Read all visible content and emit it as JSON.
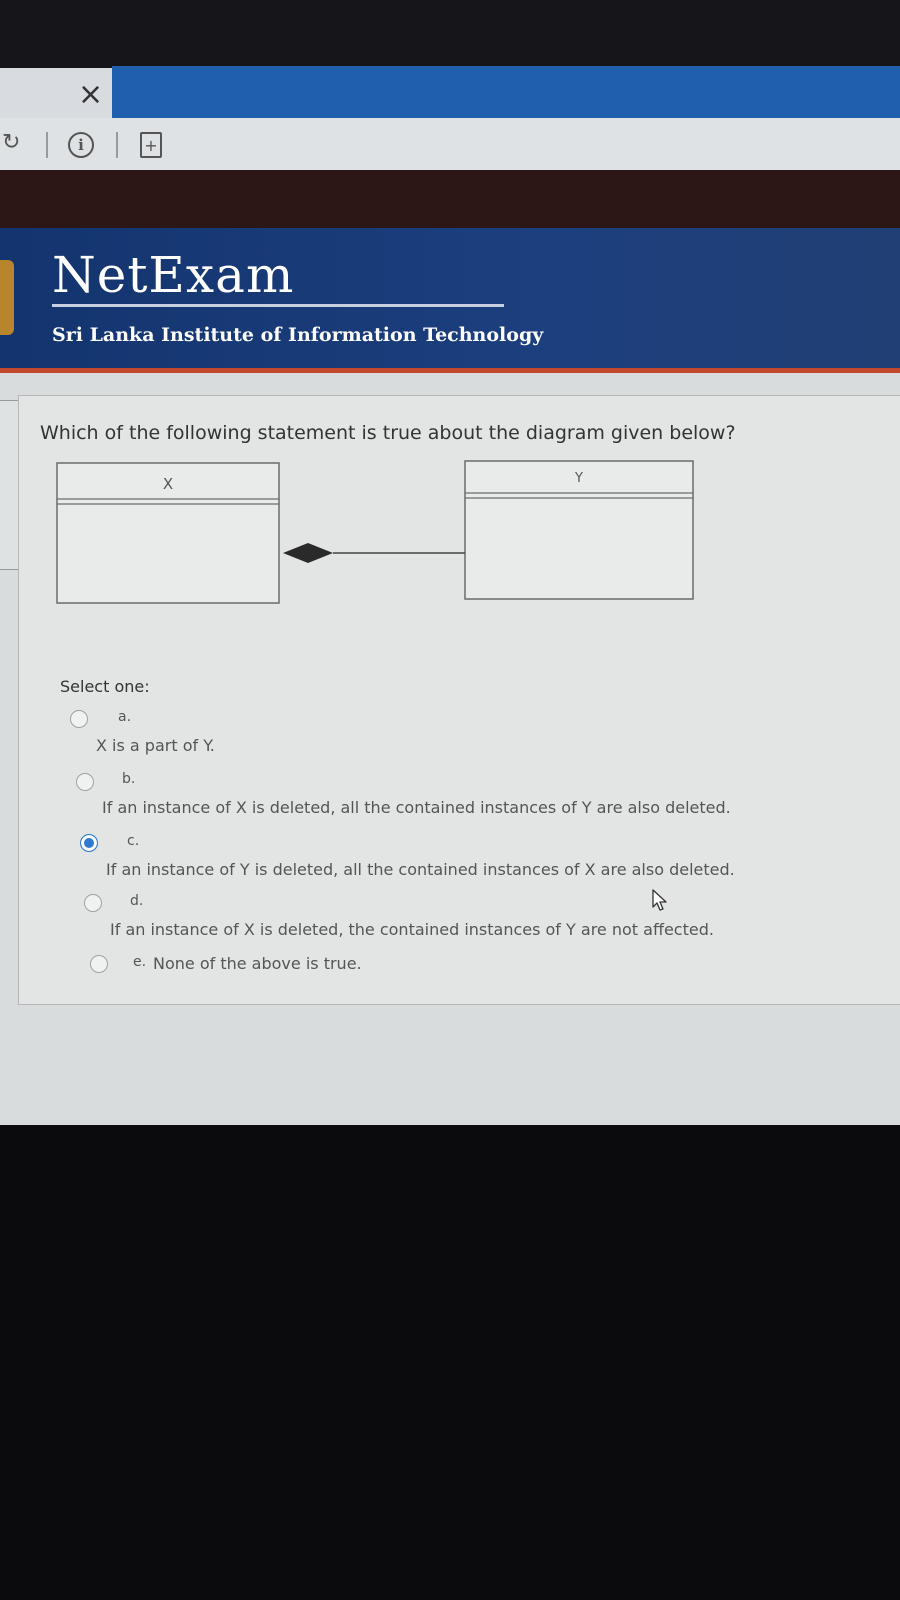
{
  "browser": {
    "close_glyph": "×",
    "refresh_glyph": "↻",
    "info_glyph": "i",
    "newtab_glyph": "+",
    "icons": [
      "close-icon",
      "refresh-icon",
      "info-icon",
      "new-tab-icon"
    ]
  },
  "header": {
    "brand": "NetExam",
    "institution": "Sri Lanka Institute of Information Technology"
  },
  "question": {
    "text": "Which of the following statement is true about the diagram given below?",
    "diagram": {
      "class_left": "X",
      "class_right": "Y",
      "relationship": "composition"
    },
    "select_label": "Select one:",
    "options": [
      {
        "letter": "a.",
        "text": "X is a part of Y.",
        "selected": false
      },
      {
        "letter": "b.",
        "text": "If an instance of X is deleted, all the contained instances of Y are also deleted.",
        "selected": false
      },
      {
        "letter": "c.",
        "text": "If an instance of Y is deleted, all the contained instances of X are also deleted.",
        "selected": true
      },
      {
        "letter": "d.",
        "text": "If an instance of X is deleted, the contained instances of Y are not affected.",
        "selected": false
      },
      {
        "letter": "e.",
        "text": "None of the above is true.",
        "selected": false
      }
    ]
  },
  "colors": {
    "banner": "#1c3f7e",
    "accent_line": "#c24a2c",
    "selected_radio": "#2f7ad0"
  }
}
